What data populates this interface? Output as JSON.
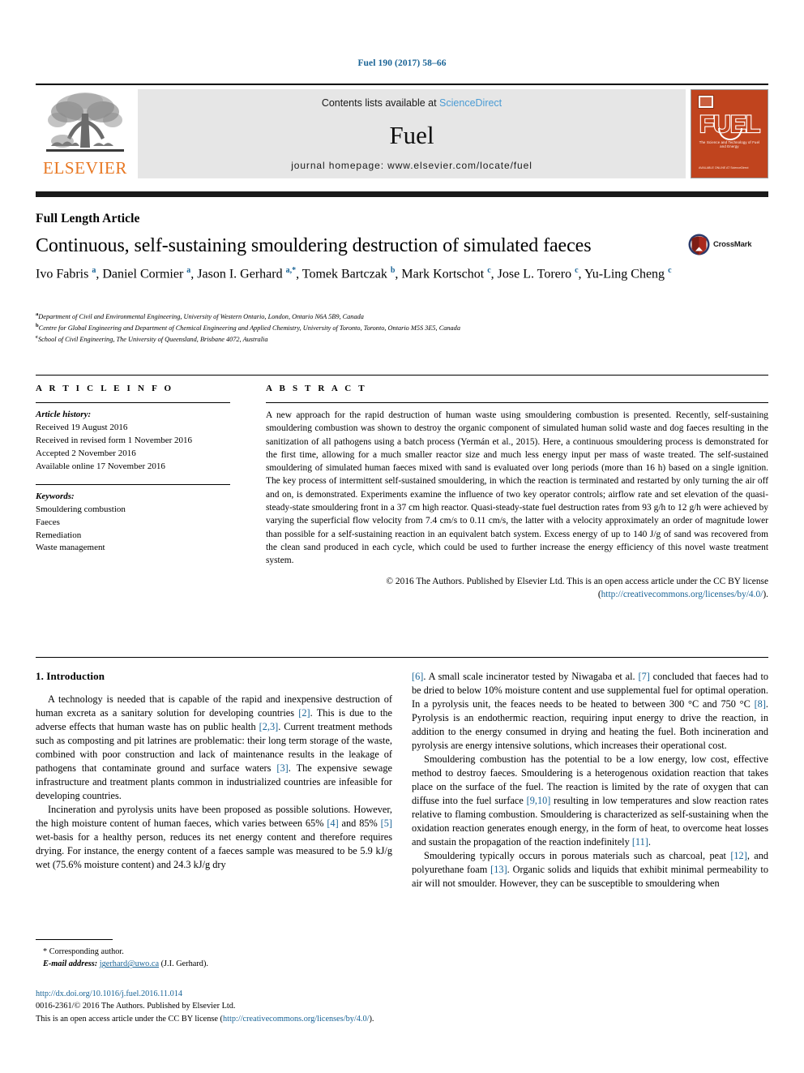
{
  "running_head": "Fuel 190 (2017) 58–66",
  "masthead": {
    "contents_prefix": "Contents lists available at ",
    "sciencedirect": "ScienceDirect",
    "journal_name": "Fuel",
    "homepage": "journal homepage: www.elsevier.com/locate/fuel",
    "publisher": "ELSEVIER",
    "cover_title": "FUEL",
    "cover_subtitle": "The Science and Technology of Fuel and Energy",
    "cover_footer": "AVAILABLE ONLINE AT\nScienceDirect"
  },
  "article": {
    "type": "Full Length Article",
    "title": "Continuous, self-sustaining smouldering destruction of simulated faeces",
    "crossmark_label": "CrossMark",
    "authors_html": "Ivo Fabris <sup>a</sup>, Daniel Cormier <sup>a</sup>, Jason I. Gerhard <sup>a,*</sup>, Tomek Bartczak <sup>b</sup>, Mark Kortschot <sup>c</sup>, Jose L. Torero <sup>c</sup>, Yu-Ling Cheng <sup>c</sup>",
    "affiliations": [
      {
        "marker": "a",
        "text": "Department of Civil and Environmental Engineering, University of Western Ontario, London, Ontario N6A 5B9, Canada"
      },
      {
        "marker": "b",
        "text": "Centre for Global Engineering and Department of Chemical Engineering and Applied Chemistry, University of Toronto, Toronto, Ontario M5S 3E5, Canada"
      },
      {
        "marker": "c",
        "text": "School of Civil Engineering, The University of Queensland, Brisbane 4072, Australia"
      }
    ]
  },
  "article_info": {
    "heading": "A R T I C L E   I N F O",
    "history_label": "Article history:",
    "history": [
      "Received 19 August 2016",
      "Received in revised form 1 November 2016",
      "Accepted 2 November 2016",
      "Available online 17 November 2016"
    ],
    "keywords_label": "Keywords:",
    "keywords": [
      "Smouldering combustion",
      "Faeces",
      "Remediation",
      "Waste management"
    ]
  },
  "abstract": {
    "heading": "A B S T R A C T",
    "text": "A new approach for the rapid destruction of human waste using smouldering combustion is presented. Recently, self-sustaining smouldering combustion was shown to destroy the organic component of simulated human solid waste and dog faeces resulting in the sanitization of all pathogens using a batch process (Yermán et al., 2015). Here, a continuous smouldering process is demonstrated for the first time, allowing for a much smaller reactor size and much less energy input per mass of waste treated. The self-sustained smouldering of simulated human faeces mixed with sand is evaluated over long periods (more than 16 h) based on a single ignition. The key process of intermittent self-sustained smouldering, in which the reaction is terminated and restarted by only turning the air off and on, is demonstrated. Experiments examine the influence of two key operator controls; airflow rate and set elevation of the quasi-steady-state smouldering front in a 37 cm high reactor. Quasi-steady-state fuel destruction rates from 93 g/h to 12 g/h were achieved by varying the superficial flow velocity from 7.4 cm/s to 0.11 cm/s, the latter with a velocity approximately an order of magnitude lower than possible for a self-sustaining reaction in an equivalent batch system. Excess energy of up to 140 J/g of sand was recovered from the clean sand produced in each cycle, which could be used to further increase the energy efficiency of this novel waste treatment system.",
    "copyright_lead": "© 2016 The Authors. Published by Elsevier Ltd. This is an open access article under the CC BY license (",
    "copyright_link": "http://creativecommons.org/licenses/by/4.0/",
    "copyright_tail": ")."
  },
  "introduction": {
    "heading": "1. Introduction",
    "left_paragraphs_html": [
      "A technology is needed that is capable of the rapid and inexpensive destruction of human excreta as a sanitary solution for developing countries <span class=\"ref\">[2]</span>. This is due to the adverse effects that human waste has on public health <span class=\"ref\">[2,3]</span>. Current treatment methods such as composting and pit latrines are problematic: their long term storage of the waste, combined with poor construction and lack of maintenance results in the leakage of pathogens that contaminate ground and surface waters <span class=\"ref\">[3]</span>. The expensive sewage infrastructure and treatment plants common in industrialized countries are infeasible for developing countries.",
      "Incineration and pyrolysis units have been proposed as possible solutions. However, the high moisture content of human faeces, which varies between 65% <span class=\"ref\">[4]</span> and 85% <span class=\"ref\">[5]</span> wet-basis for a healthy person, reduces its net energy content and therefore requires drying. For instance, the energy content of a faeces sample was measured to be 5.9 kJ/g wet (75.6% moisture content) and 24.3 kJ/g dry"
    ],
    "right_paragraphs_html": [
      "<span class=\"ref\">[6]</span>. A small scale incinerator tested by Niwagaba et al. <span class=\"ref\">[7]</span> concluded that faeces had to be dried to below 10% moisture content and use supplemental fuel for optimal operation. In a pyrolysis unit, the feaces needs to be heated to between 300 °C and 750 °C <span class=\"ref\">[8]</span>. Pyrolysis is an endothermic reaction, requiring input energy to drive the reaction, in addition to the energy consumed in drying and heating the fuel. Both incineration and pyrolysis are energy intensive solutions, which increases their operational cost.",
      "Smouldering combustion has the potential to be a low energy, low cost, effective method to destroy faeces. Smouldering is a heterogenous oxidation reaction that takes place on the surface of the fuel. The reaction is limited by the rate of oxygen that can diffuse into the fuel surface <span class=\"ref\">[9,10]</span> resulting in low temperatures and slow reaction rates relative to flaming combustion. Smouldering is characterized as self-sustaining when the oxidation reaction generates enough energy, in the form of heat, to overcome heat losses and sustain the propagation of the reaction indefinitely <span class=\"ref\">[11]</span>.",
      "Smouldering typically occurs in porous materials such as charcoal, peat <span class=\"ref\">[12]</span>, and polyurethane foam <span class=\"ref\">[13]</span>. Organic solids and liquids that exhibit minimal permeability to air will not smoulder. However, they can be susceptible to smouldering when"
    ]
  },
  "footnote": {
    "corresponding": "* Corresponding author.",
    "email_label": "E-mail address:",
    "email": "jgerhard@uwo.ca",
    "email_owner": "(J.I. Gerhard)."
  },
  "page_footer": {
    "doi": "http://dx.doi.org/10.1016/j.fuel.2016.11.014",
    "issn_line": "0016-2361/© 2016 The Authors. Published by Elsevier Ltd.",
    "license_lead": "This is an open access article under the CC BY license (",
    "license_link": "http://creativecommons.org/licenses/by/4.0/",
    "license_tail": ")."
  },
  "colors": {
    "link": "#1a6496",
    "elsevier_orange": "#E87722",
    "cover_red": "#C0441E",
    "sciencedirect_blue": "#4a9bd4"
  }
}
